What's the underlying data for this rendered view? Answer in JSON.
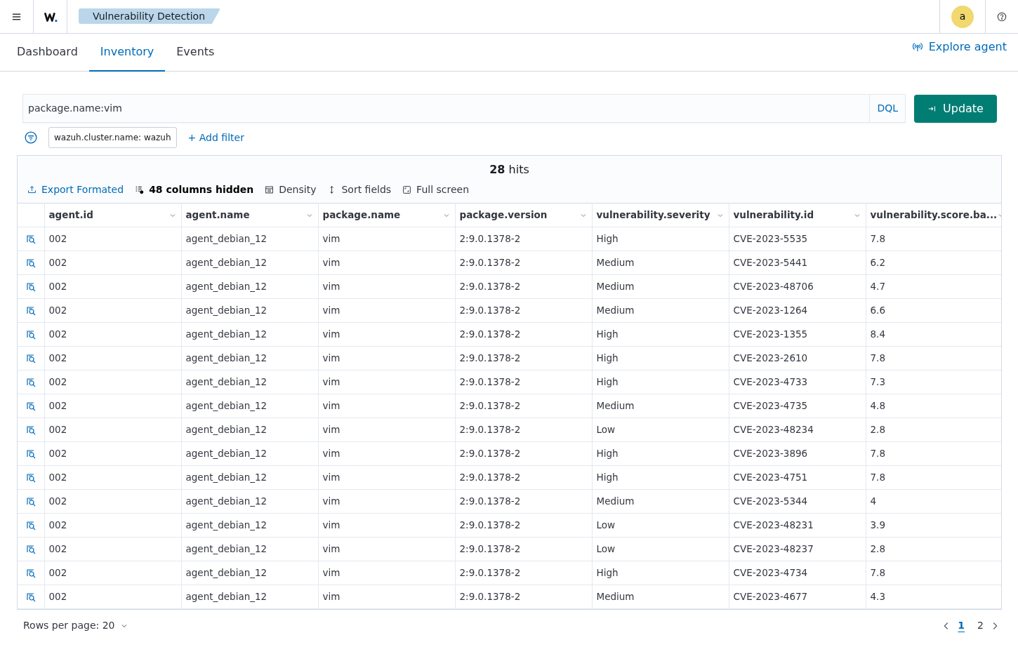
{
  "header": {
    "app_title": "Vulnerability Detection",
    "avatar": "a"
  },
  "tabs": [
    {
      "label": "Dashboard",
      "selected": false
    },
    {
      "label": "Inventory",
      "selected": true
    },
    {
      "label": "Events",
      "selected": false
    }
  ],
  "explore_agent": "Explore agent",
  "search": {
    "value": "package.name:vim",
    "language": "DQL",
    "button": "Update"
  },
  "filters": [
    {
      "label": "wazuh.cluster.name: wazuh"
    }
  ],
  "add_filter": "+ Add filter",
  "hits": {
    "count": "28",
    "label": "hits"
  },
  "toolbar": [
    {
      "kind": "export",
      "label": "Export Formated"
    },
    {
      "kind": "columns",
      "label": "48 columns hidden"
    },
    {
      "kind": "density",
      "label": "Density"
    },
    {
      "kind": "sort",
      "label": "Sort fields"
    },
    {
      "kind": "fullscreen",
      "label": "Full screen"
    }
  ],
  "table": {
    "columns": [
      "agent.id",
      "agent.name",
      "package.name",
      "package.version",
      "vulnerability.severity",
      "vulnerability.id",
      "vulnerability.score.ba..."
    ],
    "rows": [
      [
        "002",
        "agent_debian_12",
        "vim",
        "2:9.0.1378-2",
        "High",
        "CVE-2023-5535",
        "7.8"
      ],
      [
        "002",
        "agent_debian_12",
        "vim",
        "2:9.0.1378-2",
        "Medium",
        "CVE-2023-5441",
        "6.2"
      ],
      [
        "002",
        "agent_debian_12",
        "vim",
        "2:9.0.1378-2",
        "Medium",
        "CVE-2023-48706",
        "4.7"
      ],
      [
        "002",
        "agent_debian_12",
        "vim",
        "2:9.0.1378-2",
        "Medium",
        "CVE-2023-1264",
        "6.6"
      ],
      [
        "002",
        "agent_debian_12",
        "vim",
        "2:9.0.1378-2",
        "High",
        "CVE-2023-1355",
        "8.4"
      ],
      [
        "002",
        "agent_debian_12",
        "vim",
        "2:9.0.1378-2",
        "High",
        "CVE-2023-2610",
        "7.8"
      ],
      [
        "002",
        "agent_debian_12",
        "vim",
        "2:9.0.1378-2",
        "High",
        "CVE-2023-4733",
        "7.3"
      ],
      [
        "002",
        "agent_debian_12",
        "vim",
        "2:9.0.1378-2",
        "Medium",
        "CVE-2023-4735",
        "4.8"
      ],
      [
        "002",
        "agent_debian_12",
        "vim",
        "2:9.0.1378-2",
        "Low",
        "CVE-2023-48234",
        "2.8"
      ],
      [
        "002",
        "agent_debian_12",
        "vim",
        "2:9.0.1378-2",
        "High",
        "CVE-2023-3896",
        "7.8"
      ],
      [
        "002",
        "agent_debian_12",
        "vim",
        "2:9.0.1378-2",
        "High",
        "CVE-2023-4751",
        "7.8"
      ],
      [
        "002",
        "agent_debian_12",
        "vim",
        "2:9.0.1378-2",
        "Medium",
        "CVE-2023-5344",
        "4"
      ],
      [
        "002",
        "agent_debian_12",
        "vim",
        "2:9.0.1378-2",
        "Low",
        "CVE-2023-48231",
        "3.9"
      ],
      [
        "002",
        "agent_debian_12",
        "vim",
        "2:9.0.1378-2",
        "Low",
        "CVE-2023-48237",
        "2.8"
      ],
      [
        "002",
        "agent_debian_12",
        "vim",
        "2:9.0.1378-2",
        "High",
        "CVE-2023-4734",
        "7.8"
      ],
      [
        "002",
        "agent_debian_12",
        "vim",
        "2:9.0.1378-2",
        "Medium",
        "CVE-2023-4677",
        "4.3"
      ]
    ]
  },
  "pagination": {
    "rows_per_page": "Rows per page: 20",
    "pages": [
      {
        "label": "1",
        "selected": true
      },
      {
        "label": "2",
        "selected": false
      }
    ]
  }
}
